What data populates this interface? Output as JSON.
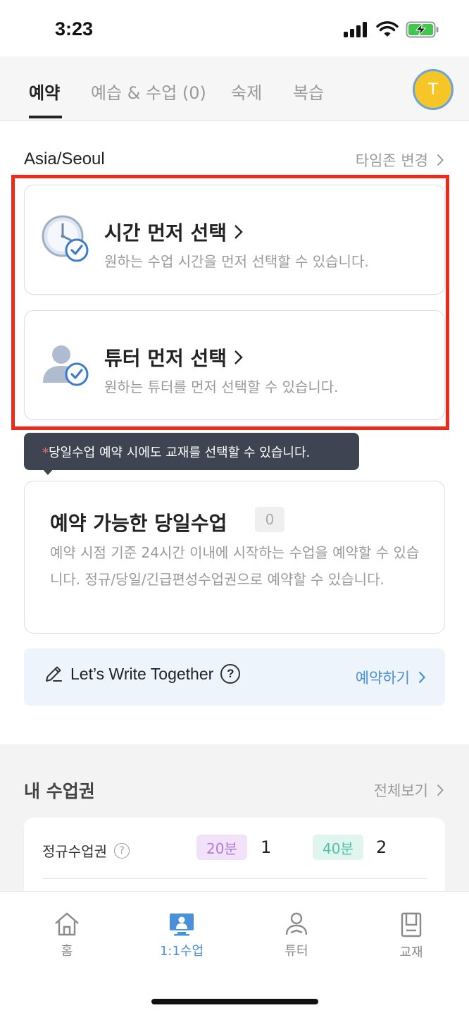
{
  "status": {
    "time": "3:23"
  },
  "tabs": [
    {
      "label": "예약"
    },
    {
      "label": "예습 & 수업 (0)"
    },
    {
      "label": "숙제"
    },
    {
      "label": "복습"
    }
  ],
  "avatar": {
    "initial": "T"
  },
  "timezone": {
    "label": "Asia/Seoul",
    "change_label": "타임존 변경"
  },
  "cards": {
    "time_first": {
      "title": "시간 먼저 선택",
      "subtitle": "원하는 수업 시간을 먼저 선택할 수 있습니다."
    },
    "tutor_first": {
      "title": "튜터 먼저 선택",
      "subtitle": "원하는 튜터를 먼저 선택할 수 있습니다."
    }
  },
  "tooltip": {
    "star": "*",
    "text": "당일수업 예약 시에도 교재를 선택할 수 있습니다."
  },
  "sameday": {
    "title": "예약 가능한 당일수업",
    "count": "0",
    "description": "예약 시점 기준 24시간 이내에 시작하는 수업을 예약할 수 있습니다. 정규/당일/긴급편성수업권으로 예약할 수 있습니다."
  },
  "lwt": {
    "label": "Let’s Write Together",
    "help": "?",
    "action": "예약하기"
  },
  "tickets": {
    "title": "내 수업권",
    "view_all": "전체보기",
    "rows": [
      {
        "label": "정규수업권",
        "help": "?",
        "pill1": "20분",
        "count1": "1",
        "pill2": "40분",
        "count2": "2"
      }
    ]
  },
  "nav": [
    {
      "label": "홈",
      "icon": "home-icon"
    },
    {
      "label": "1:1수업",
      "icon": "lesson-icon"
    },
    {
      "label": "튜터",
      "icon": "tutor-icon"
    },
    {
      "label": "교재",
      "icon": "book-icon"
    }
  ],
  "colors": {
    "highlight": "#ee2a1b",
    "accent": "#4a90d9",
    "avatar": "#f6c629"
  }
}
